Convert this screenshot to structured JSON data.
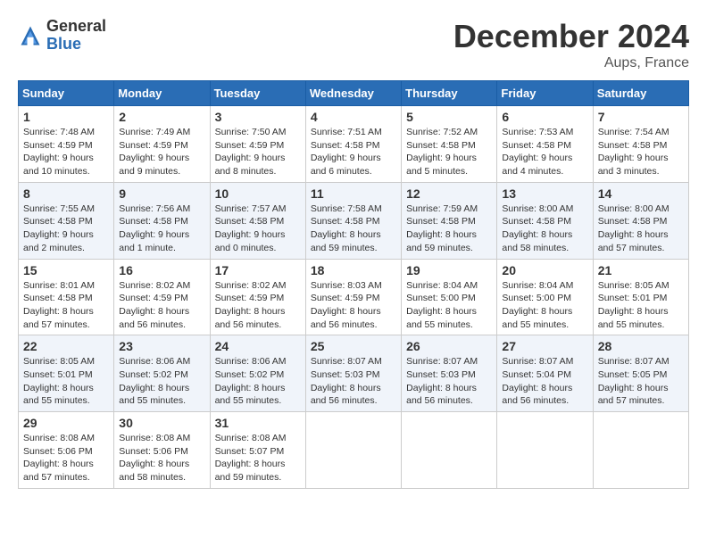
{
  "header": {
    "logo_general": "General",
    "logo_blue": "Blue",
    "title": "December 2024",
    "location": "Aups, France"
  },
  "columns": [
    "Sunday",
    "Monday",
    "Tuesday",
    "Wednesday",
    "Thursday",
    "Friday",
    "Saturday"
  ],
  "weeks": [
    [
      {
        "day": "1",
        "lines": [
          "Sunrise: 7:48 AM",
          "Sunset: 4:59 PM",
          "Daylight: 9 hours",
          "and 10 minutes."
        ]
      },
      {
        "day": "2",
        "lines": [
          "Sunrise: 7:49 AM",
          "Sunset: 4:59 PM",
          "Daylight: 9 hours",
          "and 9 minutes."
        ]
      },
      {
        "day": "3",
        "lines": [
          "Sunrise: 7:50 AM",
          "Sunset: 4:59 PM",
          "Daylight: 9 hours",
          "and 8 minutes."
        ]
      },
      {
        "day": "4",
        "lines": [
          "Sunrise: 7:51 AM",
          "Sunset: 4:58 PM",
          "Daylight: 9 hours",
          "and 6 minutes."
        ]
      },
      {
        "day": "5",
        "lines": [
          "Sunrise: 7:52 AM",
          "Sunset: 4:58 PM",
          "Daylight: 9 hours",
          "and 5 minutes."
        ]
      },
      {
        "day": "6",
        "lines": [
          "Sunrise: 7:53 AM",
          "Sunset: 4:58 PM",
          "Daylight: 9 hours",
          "and 4 minutes."
        ]
      },
      {
        "day": "7",
        "lines": [
          "Sunrise: 7:54 AM",
          "Sunset: 4:58 PM",
          "Daylight: 9 hours",
          "and 3 minutes."
        ]
      }
    ],
    [
      {
        "day": "8",
        "lines": [
          "Sunrise: 7:55 AM",
          "Sunset: 4:58 PM",
          "Daylight: 9 hours",
          "and 2 minutes."
        ]
      },
      {
        "day": "9",
        "lines": [
          "Sunrise: 7:56 AM",
          "Sunset: 4:58 PM",
          "Daylight: 9 hours",
          "and 1 minute."
        ]
      },
      {
        "day": "10",
        "lines": [
          "Sunrise: 7:57 AM",
          "Sunset: 4:58 PM",
          "Daylight: 9 hours",
          "and 0 minutes."
        ]
      },
      {
        "day": "11",
        "lines": [
          "Sunrise: 7:58 AM",
          "Sunset: 4:58 PM",
          "Daylight: 8 hours",
          "and 59 minutes."
        ]
      },
      {
        "day": "12",
        "lines": [
          "Sunrise: 7:59 AM",
          "Sunset: 4:58 PM",
          "Daylight: 8 hours",
          "and 59 minutes."
        ]
      },
      {
        "day": "13",
        "lines": [
          "Sunrise: 8:00 AM",
          "Sunset: 4:58 PM",
          "Daylight: 8 hours",
          "and 58 minutes."
        ]
      },
      {
        "day": "14",
        "lines": [
          "Sunrise: 8:00 AM",
          "Sunset: 4:58 PM",
          "Daylight: 8 hours",
          "and 57 minutes."
        ]
      }
    ],
    [
      {
        "day": "15",
        "lines": [
          "Sunrise: 8:01 AM",
          "Sunset: 4:58 PM",
          "Daylight: 8 hours",
          "and 57 minutes."
        ]
      },
      {
        "day": "16",
        "lines": [
          "Sunrise: 8:02 AM",
          "Sunset: 4:59 PM",
          "Daylight: 8 hours",
          "and 56 minutes."
        ]
      },
      {
        "day": "17",
        "lines": [
          "Sunrise: 8:02 AM",
          "Sunset: 4:59 PM",
          "Daylight: 8 hours",
          "and 56 minutes."
        ]
      },
      {
        "day": "18",
        "lines": [
          "Sunrise: 8:03 AM",
          "Sunset: 4:59 PM",
          "Daylight: 8 hours",
          "and 56 minutes."
        ]
      },
      {
        "day": "19",
        "lines": [
          "Sunrise: 8:04 AM",
          "Sunset: 5:00 PM",
          "Daylight: 8 hours",
          "and 55 minutes."
        ]
      },
      {
        "day": "20",
        "lines": [
          "Sunrise: 8:04 AM",
          "Sunset: 5:00 PM",
          "Daylight: 8 hours",
          "and 55 minutes."
        ]
      },
      {
        "day": "21",
        "lines": [
          "Sunrise: 8:05 AM",
          "Sunset: 5:01 PM",
          "Daylight: 8 hours",
          "and 55 minutes."
        ]
      }
    ],
    [
      {
        "day": "22",
        "lines": [
          "Sunrise: 8:05 AM",
          "Sunset: 5:01 PM",
          "Daylight: 8 hours",
          "and 55 minutes."
        ]
      },
      {
        "day": "23",
        "lines": [
          "Sunrise: 8:06 AM",
          "Sunset: 5:02 PM",
          "Daylight: 8 hours",
          "and 55 minutes."
        ]
      },
      {
        "day": "24",
        "lines": [
          "Sunrise: 8:06 AM",
          "Sunset: 5:02 PM",
          "Daylight: 8 hours",
          "and 55 minutes."
        ]
      },
      {
        "day": "25",
        "lines": [
          "Sunrise: 8:07 AM",
          "Sunset: 5:03 PM",
          "Daylight: 8 hours",
          "and 56 minutes."
        ]
      },
      {
        "day": "26",
        "lines": [
          "Sunrise: 8:07 AM",
          "Sunset: 5:03 PM",
          "Daylight: 8 hours",
          "and 56 minutes."
        ]
      },
      {
        "day": "27",
        "lines": [
          "Sunrise: 8:07 AM",
          "Sunset: 5:04 PM",
          "Daylight: 8 hours",
          "and 56 minutes."
        ]
      },
      {
        "day": "28",
        "lines": [
          "Sunrise: 8:07 AM",
          "Sunset: 5:05 PM",
          "Daylight: 8 hours",
          "and 57 minutes."
        ]
      }
    ],
    [
      {
        "day": "29",
        "lines": [
          "Sunrise: 8:08 AM",
          "Sunset: 5:06 PM",
          "Daylight: 8 hours",
          "and 57 minutes."
        ]
      },
      {
        "day": "30",
        "lines": [
          "Sunrise: 8:08 AM",
          "Sunset: 5:06 PM",
          "Daylight: 8 hours",
          "and 58 minutes."
        ]
      },
      {
        "day": "31",
        "lines": [
          "Sunrise: 8:08 AM",
          "Sunset: 5:07 PM",
          "Daylight: 8 hours",
          "and 59 minutes."
        ]
      },
      null,
      null,
      null,
      null
    ]
  ]
}
